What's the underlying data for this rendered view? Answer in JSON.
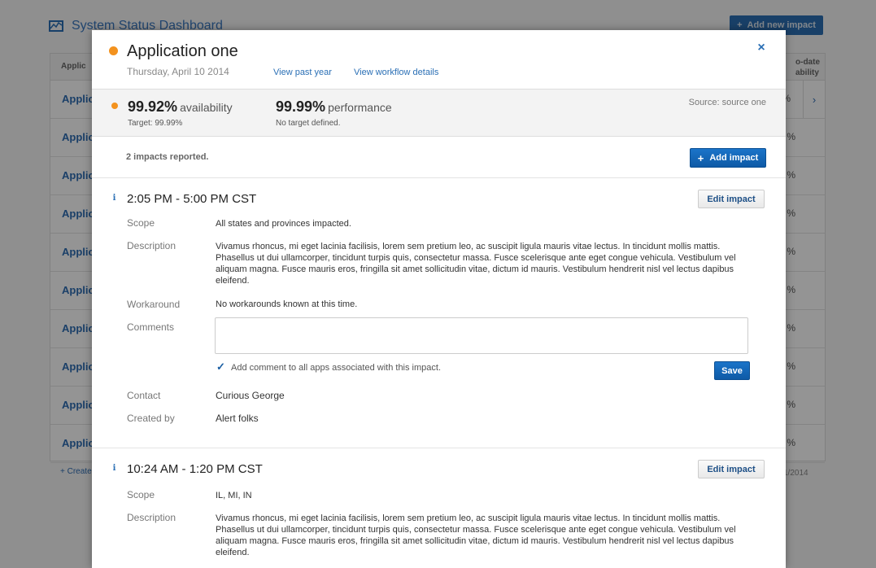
{
  "background": {
    "title": "System Status Dashboard",
    "add_button_label": "Add new impact",
    "table_head_left": "Applic",
    "table_head_right_1": "o-date",
    "table_head_right_2": "ability",
    "rows": [
      {
        "app": "Applic",
        "value": "%"
      },
      {
        "app": "Applic",
        "value": "%"
      },
      {
        "app": "Applic",
        "value": "%"
      },
      {
        "app": "Applic",
        "value": "%"
      },
      {
        "app": "Applic",
        "value": "%"
      },
      {
        "app": "Applic",
        "value": "%"
      },
      {
        "app": "Applic",
        "value": "%"
      },
      {
        "app": "Applic",
        "value": "%"
      },
      {
        "app": "Applic",
        "value": "%"
      },
      {
        "app": "Applic",
        "value": "%"
      }
    ],
    "footer_link": "+ Create",
    "footer_date": "1/2014"
  },
  "modal": {
    "title": "Application one",
    "date": "Thursday, April 10 2014",
    "link_past_year": "View past year",
    "link_workflow": "View workflow details",
    "close_glyph": "×",
    "status_color": "#f3921e",
    "availability_value": "99.92%",
    "availability_label": "availability",
    "availability_target": "Target: 99.99%",
    "performance_value": "99.99%",
    "performance_label": "performance",
    "performance_target": "No target defined.",
    "source": "Source: source one",
    "impacts_count": "2 impacts reported.",
    "add_impact_label": "Add impact",
    "impacts": [
      {
        "time": "2:05 PM - 5:00 PM CST",
        "edit_label": "Edit impact",
        "scope_label": "Scope",
        "scope": "All states and provinces impacted.",
        "description_label": "Description",
        "description": "Vivamus rhoncus, mi eget lacinia facilisis, lorem sem pretium leo, ac suscipit ligula mauris vitae lectus. In tincidunt mollis mattis. Phasellus ut dui ullamcorper, tincidunt turpis quis, consectetur massa. Fusce scelerisque ante eget congue vehicula. Vestibulum vel aliquam magna. Fusce mauris eros, fringilla sit amet sollicitudin vitae, dictum id mauris. Vestibulum hendrerit nisl vel lectus dapibus eleifend.",
        "workaround_label": "Workaround",
        "workaround": "No workarounds known at this time.",
        "comments_label": "Comments",
        "comment_value": "",
        "checkbox_checked": true,
        "checkbox_label": "Add comment to all apps associated with this impact.",
        "save_label": "Save",
        "contact_label": "Contact",
        "contact": "Curious George",
        "created_by_label": "Created by",
        "created_by": "Alert folks"
      },
      {
        "time": "10:24 AM - 1:20 PM CST",
        "edit_label": "Edit impact",
        "scope_label": "Scope",
        "scope": "IL, MI, IN",
        "description_label": "Description",
        "description": "Vivamus rhoncus, mi eget lacinia facilisis, lorem sem pretium leo, ac suscipit ligula mauris vitae lectus. In tincidunt mollis mattis. Phasellus ut dui ullamcorper, tincidunt turpis quis, consectetur massa. Fusce scelerisque ante eget congue vehicula. Vestibulum vel aliquam magna. Fusce mauris eros, fringilla sit amet sollicitudin vitae, dictum id mauris. Vestibulum hendrerit nisl vel lectus dapibus eleifend."
      }
    ]
  }
}
